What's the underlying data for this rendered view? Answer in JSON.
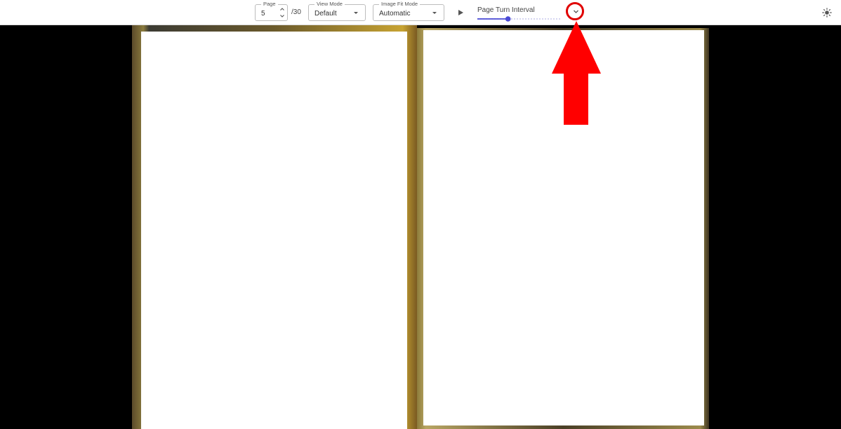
{
  "toolbar": {
    "page": {
      "label": "Page",
      "value": "5",
      "total": "/30"
    },
    "view_mode": {
      "label": "View Mode",
      "value": "Default"
    },
    "image_fit_mode": {
      "label": "Image Fit Mode",
      "value": "Automatic"
    },
    "page_turn_interval": {
      "label": "Page Turn Interval",
      "level": 0.37
    },
    "icons": {
      "play": "play-icon",
      "expand": "chevron-down-icon",
      "theme": "sun-icon"
    }
  },
  "reader": {
    "pages_shown": 2
  },
  "colors": {
    "accent": "#4a4ad6",
    "annotation": "#e00000",
    "background": "#000000"
  }
}
